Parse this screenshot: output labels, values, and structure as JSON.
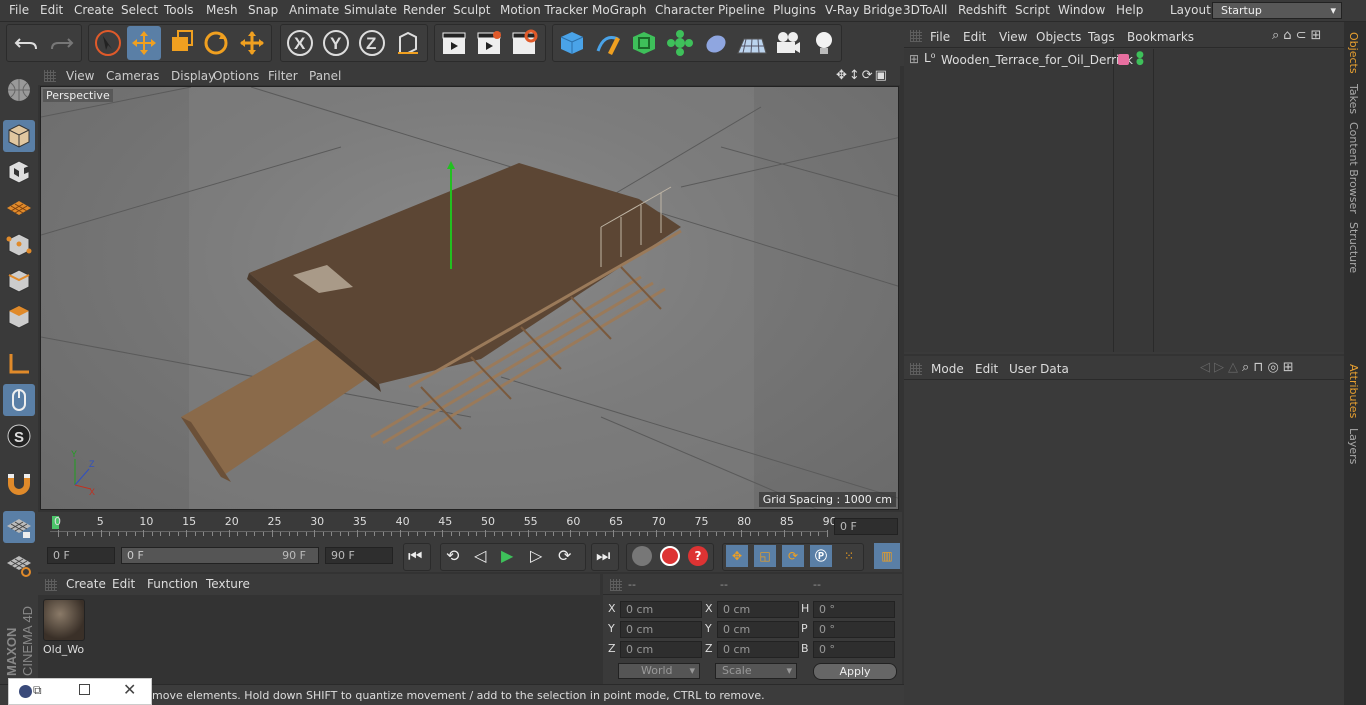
{
  "menubar": {
    "items": [
      "File",
      "Edit",
      "Create",
      "Select",
      "Tools",
      "Mesh",
      "Snap",
      "Animate",
      "Simulate",
      "Render",
      "Sculpt",
      "Motion Tracker",
      "MoGraph",
      "Character",
      "Pipeline",
      "Plugins",
      "V-Ray Bridge",
      "3DToAll",
      "Redshift",
      "Script",
      "Window",
      "Help"
    ],
    "layout_label": "Layout:",
    "layout_value": "Startup"
  },
  "viewport": {
    "menu": [
      "View",
      "Cameras",
      "Display",
      "Options",
      "Filter",
      "Panel"
    ],
    "camera": "Perspective",
    "grid_spacing": "Grid Spacing : 1000 cm"
  },
  "timeline": {
    "ticks": [
      "0",
      "5",
      "10",
      "15",
      "20",
      "25",
      "30",
      "35",
      "40",
      "45",
      "50",
      "55",
      "60",
      "65",
      "70",
      "75",
      "80",
      "85",
      "90"
    ],
    "current_frame": "0 F"
  },
  "transport": {
    "start": "0 F",
    "range_start": "0 F",
    "range_end": "90 F",
    "end": "90 F"
  },
  "materials": {
    "menu": [
      "Create",
      "Edit",
      "Function",
      "Texture"
    ],
    "items": [
      {
        "name": "Old_Wo"
      }
    ]
  },
  "coords": {
    "headers": [
      "--",
      "--",
      "--"
    ],
    "rows": [
      {
        "l1": "X",
        "v1": "0 cm",
        "l2": "X",
        "v2": "0 cm",
        "l3": "H",
        "v3": "0 °"
      },
      {
        "l1": "Y",
        "v1": "0 cm",
        "l2": "Y",
        "v2": "0 cm",
        "l3": "P",
        "v3": "0 °"
      },
      {
        "l1": "Z",
        "v1": "0 cm",
        "l2": "Z",
        "v2": "0 cm",
        "l3": "B",
        "v3": "0 °"
      }
    ],
    "mode": "World",
    "scale": "Scale",
    "apply": "Apply"
  },
  "status": "move elements. Hold down SHIFT to quantize movement / add to the selection in point mode, CTRL to remove.",
  "objects": {
    "menu": [
      "File",
      "Edit",
      "View",
      "Objects",
      "Tags",
      "Bookmarks"
    ],
    "items": [
      {
        "name": "Wooden_Terrace_for_Oil_Derrick",
        "tag_color": "#e86fa0"
      }
    ]
  },
  "attributes": {
    "menu": [
      "Mode",
      "Edit",
      "User Data"
    ]
  },
  "right_tabs": [
    "Objects",
    "Takes",
    "Content Browser",
    "Structure",
    "Attributes",
    "Layers"
  ],
  "branding": "MAXON CINEMA 4D"
}
